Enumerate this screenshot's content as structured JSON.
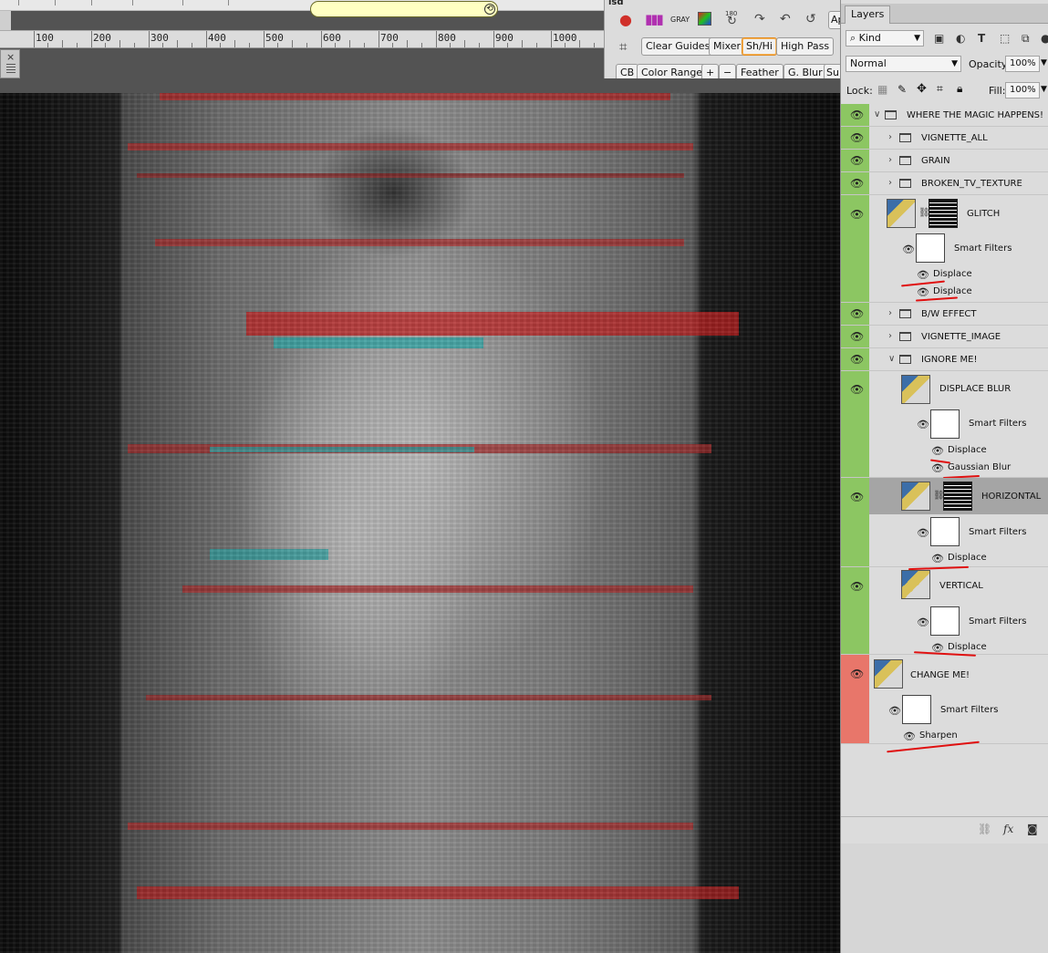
{
  "ruler": {
    "ticks": [
      "100",
      "200",
      "300",
      "400",
      "500",
      "600",
      "700",
      "800",
      "900",
      "1000"
    ]
  },
  "action_panel": {
    "title": "isd",
    "row1_icons": [
      "rgb-channels-icon",
      "color-bars-icon",
      "gray-label",
      "color-square-icon",
      "rotate-180-icon",
      "redo-icon",
      "undo-icon",
      "history-icon"
    ],
    "gray_label": "GRAY",
    "rotate_label": "180",
    "ap_label": "Ap",
    "buttons_row1": [
      "Clear Guides",
      "Mixer",
      "Sh/Hi",
      "High Pass"
    ],
    "buttons_row2": [
      "CB",
      "Color Range",
      "+",
      "−",
      "Feather",
      "G. Blur",
      "Su"
    ]
  },
  "layers_panel": {
    "tab": "Layers",
    "filter_kind": "Kind",
    "blend_mode": "Normal",
    "opacity_label": "Opacity:",
    "opacity_value": "100%",
    "lock_label": "Lock:",
    "fill_label": "Fill:",
    "fill_value": "100%",
    "groups": {
      "root": "WHERE THE MAGIC HAPPENS!",
      "vignette_all": "VIGNETTE_ALL",
      "grain": "GRAIN",
      "broken_tv": "BROKEN_TV_TEXTURE",
      "bw_effect": "B/W EFFECT",
      "vignette_image": "VIGNETTE_IMAGE",
      "ignore_me": "IGNORE ME!"
    },
    "layers": {
      "glitch": "GLITCH",
      "displace_blur": "DISPLACE BLUR",
      "horizontal": "HORIZONTAL",
      "vertical": "VERTICAL",
      "change_me": "CHANGE ME!"
    },
    "smart_filters": "Smart Filters",
    "filters": {
      "displace": "Displace",
      "gaussian_blur": "Gaussian Blur",
      "sharpen": "Sharpen"
    },
    "colors": {
      "green": "#8cc662",
      "red": "#e8766a",
      "selected": "#a5a5a5"
    }
  }
}
